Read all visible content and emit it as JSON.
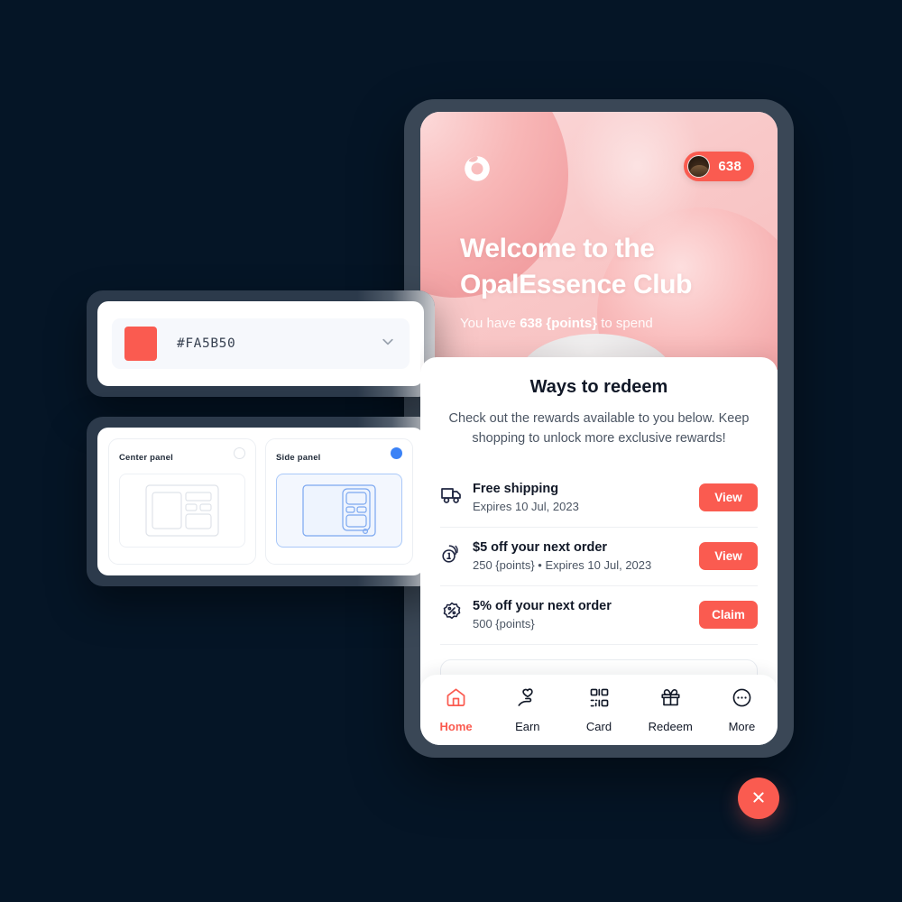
{
  "theme": {
    "background": "#051526",
    "accent": "#FA5B50",
    "phone_frame": "#3A4756",
    "radio_selected": "#3B82F6"
  },
  "phone": {
    "hero": {
      "logo_icon": "opal-swirl-logo-icon",
      "points_badge": {
        "avatar_icon": "user-avatar",
        "value": "638"
      },
      "title": "Welcome to the OpalEssence Club",
      "subtitle_prefix": "You have ",
      "subtitle_points": "638 {points}",
      "subtitle_suffix": " to spend"
    },
    "sheet": {
      "title": "Ways to redeem",
      "description": "Check out the rewards available to you below. Keep shopping to unlock more exclusive rewards!",
      "rewards": [
        {
          "icon": "truck-icon",
          "name": "Free shipping",
          "meta": "Expires 10 Jul, 2023",
          "action": "View"
        },
        {
          "icon": "coins-icon",
          "name": "$5 off your next order",
          "meta": "250 {points} • Expires 10 Jul, 2023",
          "action": "View"
        },
        {
          "icon": "percent-badge-icon",
          "name": "5% off your next order",
          "meta": "500 {points}",
          "action": "Claim"
        }
      ]
    },
    "tabbar": [
      {
        "icon": "home-icon",
        "label": "Home",
        "active": true
      },
      {
        "icon": "earn-hand-heart-icon",
        "label": "Earn",
        "active": false
      },
      {
        "icon": "qr-card-icon",
        "label": "Card",
        "active": false
      },
      {
        "icon": "gift-icon",
        "label": "Redeem",
        "active": false
      },
      {
        "icon": "more-dots-icon",
        "label": "More",
        "active": false
      }
    ]
  },
  "color_panel": {
    "swatch_color": "#FA5B50",
    "value": "#FA5B50",
    "chevron_icon": "chevron-down-icon"
  },
  "layout_panel": {
    "options": [
      {
        "label": "Center panel",
        "selected": false
      },
      {
        "label": "Side panel",
        "selected": true
      }
    ]
  },
  "close_button": {
    "icon": "close-icon",
    "aria": "Close"
  }
}
